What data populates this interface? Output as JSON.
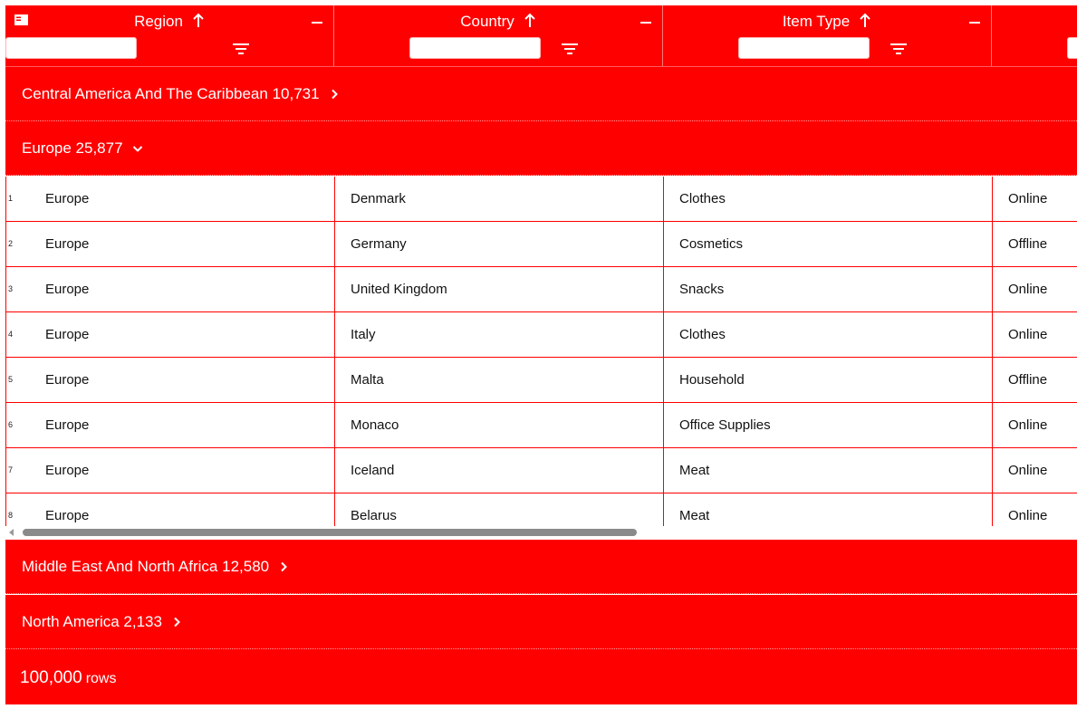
{
  "header": {
    "columns": [
      {
        "title": "Region",
        "sort": "ascending"
      },
      {
        "title": "Country",
        "sort": "ascending"
      },
      {
        "title": "Item Type",
        "sort": "ascending"
      },
      {
        "title": "",
        "sort": ""
      }
    ]
  },
  "groups": [
    {
      "label": "Central America And The Caribbean 10,731",
      "expanded": false
    },
    {
      "label": "Europe 25,877",
      "expanded": true
    },
    {
      "label": "Middle East And North Africa 12,580",
      "expanded": false
    },
    {
      "label": "North America 2,133",
      "expanded": false
    }
  ],
  "rows": [
    {
      "num": "1",
      "region": "Europe",
      "country": "Denmark",
      "item_type": "Clothes",
      "channel": "Online"
    },
    {
      "num": "2",
      "region": "Europe",
      "country": "Germany",
      "item_type": "Cosmetics",
      "channel": "Offline"
    },
    {
      "num": "3",
      "region": "Europe",
      "country": "United Kingdom",
      "item_type": "Snacks",
      "channel": "Online"
    },
    {
      "num": "4",
      "region": "Europe",
      "country": "Italy",
      "item_type": "Clothes",
      "channel": "Online"
    },
    {
      "num": "5",
      "region": "Europe",
      "country": "Malta",
      "item_type": "Household",
      "channel": "Offline"
    },
    {
      "num": "6",
      "region": "Europe",
      "country": "Monaco",
      "item_type": "Office Supplies",
      "channel": "Online"
    },
    {
      "num": "7",
      "region": "Europe",
      "country": "Iceland",
      "item_type": "Meat",
      "channel": "Online"
    },
    {
      "num": "8",
      "region": "Europe",
      "country": "Belarus",
      "item_type": "Meat",
      "channel": "Online"
    }
  ],
  "footer": {
    "row_count": "100,000",
    "row_unit": "rows"
  },
  "colors": {
    "accent": "#ff0000",
    "text": "#111111",
    "scroll_thumb": "#8a8a8a"
  },
  "icons": {
    "menu": "grid-menu-icon",
    "sort": "arrow-up-icon",
    "minimize": "minimize-icon",
    "filter": "filter-icon",
    "collapsed": "chevron-right-icon",
    "expanded": "chevron-down-icon"
  }
}
